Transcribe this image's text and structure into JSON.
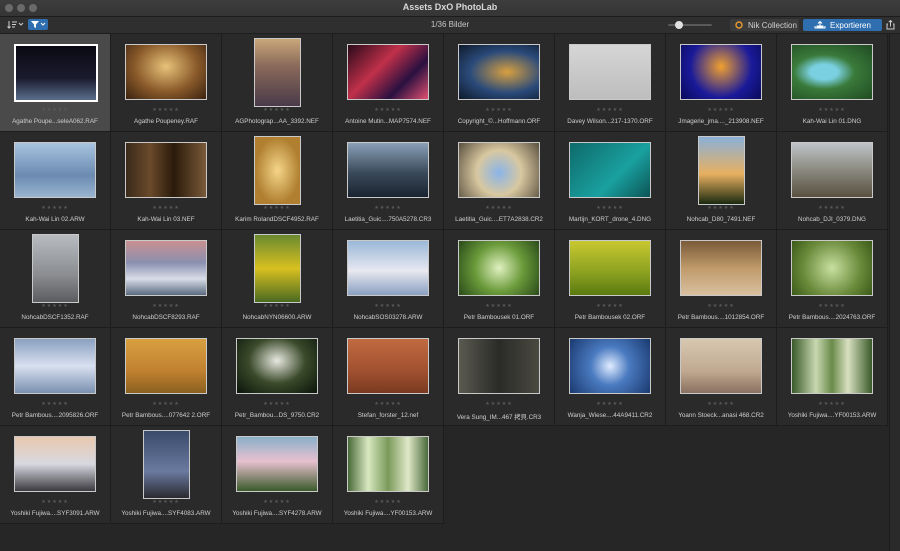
{
  "window": {
    "title": "Assets DxO PhotoLab"
  },
  "toolbar": {
    "counter": "1/36 Bilder",
    "zoom_level": 0.25,
    "nik_label": "Nik Collection",
    "export_label": "Exportieren"
  },
  "icons": {
    "sort": "sort-icon",
    "filter": "filter-icon",
    "nik": "nik-icon",
    "export": "export-icon",
    "share": "share-icon"
  },
  "colors": {
    "accent": "#2f6fb0",
    "selected": "#4a4a4a"
  },
  "rating_glyph": "★★★★★",
  "images": [
    {
      "name": "Agathe Poupe...seleA062.RAF",
      "shape": "l",
      "bg": "linear-gradient(180deg,#0a0a14,#1b1b2e 60%,#5a6e8c)"
    },
    {
      "name": "Agathe Poupeney.RAF",
      "shape": "l",
      "bg": "radial-gradient(ellipse at 50% 40%,#e8c27a,#8a5a2a 55%,#3a2210)"
    },
    {
      "name": "AGPhotograp...AA_3392.NEF",
      "shape": "p",
      "bg": "linear-gradient(180deg,#c9a67a,#8a6a5a 40%,#4a3a4a)"
    },
    {
      "name": "Antoine Mutin...MAP7574.NEF",
      "shape": "l",
      "bg": "linear-gradient(135deg,#2a0a1a,#c0304a 40%,#2a1040 70%,#e05070)"
    },
    {
      "name": "Copyright_©...Hoffmann.ORF",
      "shape": "l",
      "bg": "radial-gradient(ellipse at 60% 50%,#d8a040,#2a4a7a 55%,#0e1a2a)"
    },
    {
      "name": "Davey Wilson...217-1370.ORF",
      "shape": "l",
      "bg": "linear-gradient(180deg,#d6d6d6,#bdbdbd)"
    },
    {
      "name": "Jmagerie_jma...._213908.NEF",
      "shape": "l",
      "bg": "radial-gradient(circle at 50% 40%,#f0a030,#1a1a9a 60%,#0a0a5a)"
    },
    {
      "name": "Kah-Wai Lin 01.DNG",
      "shape": "l",
      "bg": "radial-gradient(ellipse at 40% 50%,#7ad0e0 20%,#3a7a3a 45%,#1f4a22)"
    },
    {
      "name": "Kah-Wai Lin 02.ARW",
      "shape": "l",
      "bg": "linear-gradient(180deg,#a8c4e0,#6a8ab0 60%,#9ab4d0)"
    },
    {
      "name": "Kah-Wai Lin 03.NEF",
      "shape": "l",
      "bg": "linear-gradient(90deg,#3a2a1a,#6a4a2a 30%,#2a1a0a 60%,#7a5a3a)"
    },
    {
      "name": "Karim RolandDSCF4952.RAF",
      "shape": "p",
      "bg": "radial-gradient(ellipse at 50% 50%,#f5d58a,#b08030 70%)"
    },
    {
      "name": "Laetitia_Guic....750A5278.CR3",
      "shape": "l",
      "bg": "linear-gradient(180deg,#8aa0b8,#3a4a5a 55%,#1a2430)"
    },
    {
      "name": "Laetitia_Guic....ET7A2838.CR2",
      "shape": "l",
      "bg": "radial-gradient(circle at 50% 55%,#8ab4e8,#d8c8a0 45%,#5a5040)"
    },
    {
      "name": "Martijn_KORT_drone_4.DNG",
      "shape": "l",
      "bg": "linear-gradient(135deg,#0e6a6a,#1aa0a0 60%,#0c5454)"
    },
    {
      "name": "Nohcab_D80_7491.NEF",
      "shape": "p",
      "bg": "linear-gradient(180deg,#8ab0d8,#e8b060 55%,#1a2a10)"
    },
    {
      "name": "Nohcab_DJI_0379.DNG",
      "shape": "l",
      "bg": "linear-gradient(180deg,#c0c4c8,#8a8a80 50%,#5a5040)"
    },
    {
      "name": "NohcabDSCF1352.RAF",
      "shape": "p",
      "bg": "linear-gradient(180deg,#b8bcc0,#8a8c90 60%,#5a5c60)"
    },
    {
      "name": "NohcabDSCF8293.RAF",
      "shape": "l",
      "bg": "linear-gradient(180deg,#c89090,#8a90b0 40%,#d8dde8 70%,#5a6a80)"
    },
    {
      "name": "NohcabNYN06600.ARW",
      "shape": "p",
      "bg": "linear-gradient(180deg,#6a8a30,#d8c020 50%,#4a6a20)"
    },
    {
      "name": "NohcabSOS03278.ARW",
      "shape": "l",
      "bg": "linear-gradient(180deg,#9ab8d8,#e8e8f0 55%,#8aa0c0)"
    },
    {
      "name": "Petr Bambousek 01.ORF",
      "shape": "l",
      "bg": "radial-gradient(circle at 50% 50%,#e0f0c0,#6a9a3a 50%,#2a4a1a)"
    },
    {
      "name": "Petr Bambousek 02.ORF",
      "shape": "l",
      "bg": "linear-gradient(180deg,#c8c830,#8aa020 60%,#5a7a10)"
    },
    {
      "name": "Petr Bambous....1012854.ORF",
      "shape": "l",
      "bg": "linear-gradient(180deg,#7a5a3a,#c09a6a 50%,#d8c0a0)"
    },
    {
      "name": "Petr Bambous....2024763.ORF",
      "shape": "l",
      "bg": "radial-gradient(circle at 50% 50%,#c8e0a0,#6a8a3a 60%,#3a5a1a)"
    },
    {
      "name": "Petr Bambous....2095826.ORF",
      "shape": "l",
      "bg": "linear-gradient(180deg,#8aa0c0,#d8e0f0 50%,#7a90b0)"
    },
    {
      "name": "Petr Bambous....077642 2.ORF",
      "shape": "l",
      "bg": "linear-gradient(180deg,#d8a040,#c08030 60%,#8a6020)"
    },
    {
      "name": "Petr_Bambou...DS_9750.CR2",
      "shape": "l",
      "bg": "radial-gradient(ellipse at 50% 40%,#e8e8e0,#3a4a2a 50%,#0a140a)"
    },
    {
      "name": "Stefan_forster_12.nef",
      "shape": "l",
      "bg": "linear-gradient(180deg,#c06a40,#a05030 60%,#7a3a20)"
    },
    {
      "name": "Vera Sung_IM...467 拷貝.CR3",
      "shape": "l",
      "bg": "linear-gradient(90deg,#5a5a50,#2a2a28 50%,#4a4a40)"
    },
    {
      "name": "Wanja_Wiese....44A9411.CR2",
      "shape": "l",
      "bg": "radial-gradient(circle at 50% 50%,#e0ecff,#4a7ac0 40%,#1a3a70)"
    },
    {
      "name": "Yoann Stoeck...anasi 468.CR2",
      "shape": "l",
      "bg": "linear-gradient(180deg,#d8c8b0,#c0a890 60%,#8a7060)"
    },
    {
      "name": "Yoshiki Fujiwa....YF00153.ARW",
      "shape": "l",
      "bg": "linear-gradient(90deg,#3a5a2a,#c8d8b0 30%,#6a8a4a 50%,#d8e0c0 70%,#3a5a2a)"
    },
    {
      "name": "Yoshiki Fujiwa....SYF3091.ARW",
      "shape": "l",
      "bg": "linear-gradient(180deg,#e8c8b0,#d8d8e0 50%,#3a3a40)"
    },
    {
      "name": "Yoshiki Fujiwa....SYF4083.ARW",
      "shape": "p",
      "bg": "linear-gradient(180deg,#3a4a6a,#6a7aa0 60%,#2a2a30)"
    },
    {
      "name": "Yoshiki Fujiwa....SYF4278.ARW",
      "shape": "l",
      "bg": "linear-gradient(180deg,#8ab0c8,#e8c0d0 45%,#3a5a2a)"
    },
    {
      "name": "Yoshiki Fujiwa....YF00153.ARW",
      "shape": "l",
      "bg": "linear-gradient(90deg,#4a6a3a,#d8e8c0 25%,#7a9a5a 50%,#e0e8c8 75%,#4a6a3a)"
    }
  ],
  "selected_index": 0
}
